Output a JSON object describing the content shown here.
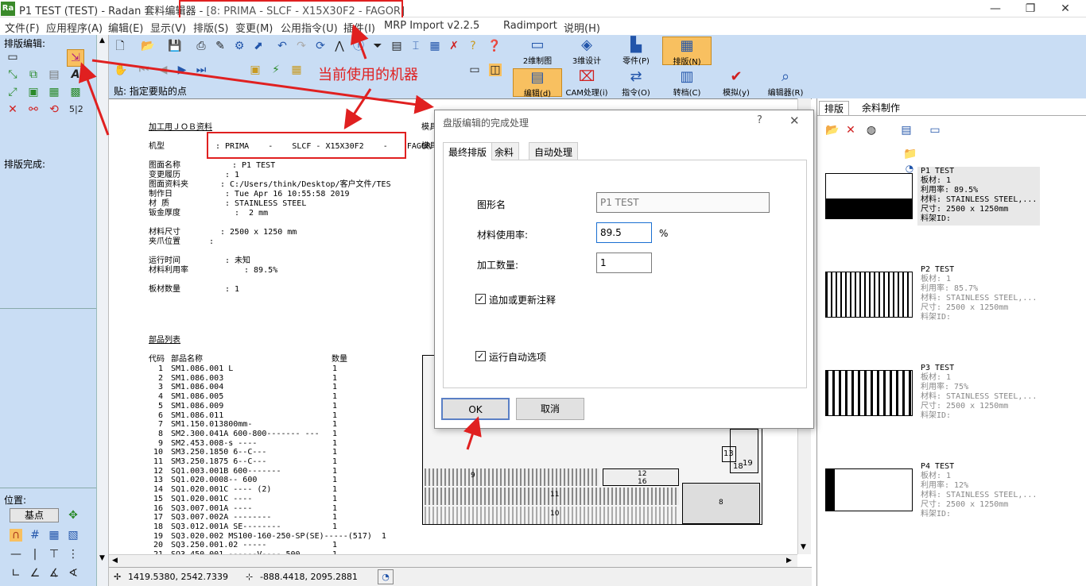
{
  "window": {
    "app_icon": "Ra",
    "title": "P1 TEST (TEST) - Radan 套料编辑器 - ",
    "title_machine": "[8: PRIMA   -   SLCF - X15X30F2   -   FAGOR]",
    "min_glyph": "—",
    "max_glyph": "❐",
    "close_glyph": "✕"
  },
  "menu": [
    "文件(F)",
    "应用程序(A)",
    "编辑(E)",
    "显示(V)",
    "排版(S)",
    "变更(M)",
    "公用指令(U)",
    "插件(I)",
    "MRP Import v2.2.5",
    "Radimport",
    "说明(H)"
  ],
  "left_panel": {
    "nest_edit_label": "排版编辑:",
    "nest_done_label": "排版完成:",
    "position_label": "位置:",
    "base_point_button": "基点",
    "fraction_label": "5|2"
  },
  "big_toolbar": {
    "row1": [
      {
        "label": "2维制图",
        "icon": "draw-2d-icon"
      },
      {
        "label": "3维设计",
        "icon": "design-3d-icon"
      },
      {
        "label": "零件(P)",
        "icon": "part-icon"
      },
      {
        "label": "排版(N)",
        "icon": "nest-icon",
        "active": true
      }
    ],
    "row2": [
      {
        "label": "编辑(d)",
        "icon": "edit-icon",
        "active": true
      },
      {
        "label": "CAM处理(i)",
        "icon": "cam-icon"
      },
      {
        "label": "指令(O)",
        "icon": "command-icon"
      },
      {
        "label": "转档(C)",
        "icon": "convert-icon"
      },
      {
        "label": "模拟(y)",
        "icon": "simulate-icon"
      },
      {
        "label": "编辑器(R)",
        "icon": "editor-icon"
      }
    ]
  },
  "prompt": "贴: 指定要贴的点",
  "annotation": "当前使用的机器",
  "job_sheet": {
    "header": "加工用ＪＯＢ资料",
    "header_right": "模具",
    "header_right2": "模具",
    "machine_label": "机型",
    "machine_value": ": PRIMA    -    SLCF - X15X30F2    -    FAGOR",
    "fields": [
      {
        "label": "图面名称",
        "value": ": P1 TEST"
      },
      {
        "label": "变更履历",
        "value": ": 1"
      },
      {
        "label": "图面资料夹",
        "value": ": C:/Users/think/Desktop/客户文件/TES"
      },
      {
        "label": "制作日",
        "value": ": Tue Apr 16 10:55:58 2019"
      },
      {
        "label": "材 质",
        "value": ": STAINLESS STEEL"
      },
      {
        "label": "钣金厚度",
        "value": ":  2 mm"
      }
    ],
    "fields2": [
      {
        "label": "材料尺寸",
        "value": ": 2500 x 1250 mm"
      },
      {
        "label": "夹爪位置",
        "value": ":"
      }
    ],
    "fields3": [
      {
        "label": "运行时间",
        "value": ": 未知"
      },
      {
        "label": "材料利用率",
        "value": ": 89.5%"
      }
    ],
    "sheet_count_label": "板材数量",
    "sheet_count_value": ": 1",
    "parts_title": "部品列表",
    "parts_header": {
      "code": "代码",
      "name": "部品名称",
      "qty": "数量"
    },
    "parts": [
      {
        "code": "1",
        "name": "SM1.086.001 L",
        "qty": "1"
      },
      {
        "code": "2",
        "name": "SM1.086.003",
        "qty": "1"
      },
      {
        "code": "3",
        "name": "SM1.086.004",
        "qty": "1"
      },
      {
        "code": "4",
        "name": "SM1.086.005",
        "qty": "1"
      },
      {
        "code": "5",
        "name": "SM1.086.009",
        "qty": "1"
      },
      {
        "code": "6",
        "name": "SM1.086.011",
        "qty": "1"
      },
      {
        "code": "7",
        "name": "SM1.150.013800mm-",
        "qty": "1"
      },
      {
        "code": "8",
        "name": "SM2.300.041A 600-800------- ---",
        "qty": "1"
      },
      {
        "code": "9",
        "name": "SM2.453.008-s ----",
        "qty": "1"
      },
      {
        "code": "10",
        "name": "SM3.250.1850 6--C---",
        "qty": "1"
      },
      {
        "code": "11",
        "name": "SM3.250.1875 6--C---",
        "qty": "1"
      },
      {
        "code": "12",
        "name": "SQ1.003.001B 600-------",
        "qty": "1"
      },
      {
        "code": "13",
        "name": "SQ1.020.0008-- 600",
        "qty": "1"
      },
      {
        "code": "14",
        "name": "SQ1.020.001C ---- (2)",
        "qty": "1"
      },
      {
        "code": "15",
        "name": "SQ1.020.001C ----",
        "qty": "1"
      },
      {
        "code": "16",
        "name": "SQ3.007.001A ----",
        "qty": "1"
      },
      {
        "code": "17",
        "name": "SQ3.007.002A --------",
        "qty": "1"
      },
      {
        "code": "18",
        "name": "SQ3.012.001A SE--------",
        "qty": "1"
      },
      {
        "code": "19",
        "name": "SQ3.020.002 MS100-160-250-SP(SE)-----(517)  1",
        "qty": ""
      },
      {
        "code": "20",
        "name": "SQ3.250.001.02 -----",
        "qty": "1"
      },
      {
        "code": "21",
        "name": "SQ3.450.001 ------V---- 500",
        "qty": "1"
      }
    ]
  },
  "nest_labels": [
    "12",
    "16",
    "11",
    "10",
    "8",
    "13",
    "18",
    "19",
    "9"
  ],
  "status": {
    "coord1": "1419.5380,  2542.7339",
    "coord2": "-888.4418,  2095.2881"
  },
  "right_panel": {
    "tabs": [
      "排版",
      "余料制作"
    ],
    "items": [
      {
        "name": "P1 TEST",
        "board": "板材: 1",
        "usage": "利用率: 89.5%",
        "material": "材料: STAINLESS STEEL,...",
        "size": "尺寸: 2500 x 1250mm",
        "rack": "料架ID:",
        "selected": true
      },
      {
        "name": "P2 TEST",
        "board": "板材: 1",
        "usage": "利用率: 85.7%",
        "material": "材料: STAINLESS STEEL,...",
        "size": "尺寸: 2500 x 1250mm",
        "rack": "料架ID:",
        "selected": false
      },
      {
        "name": "P3 TEST",
        "board": "板材: 1",
        "usage": "利用率: 75%",
        "material": "材料: STAINLESS STEEL,...",
        "size": "尺寸: 2500 x 1250mm",
        "rack": "料架ID:",
        "selected": false
      },
      {
        "name": "P4 TEST",
        "board": "板材: 1",
        "usage": "利用率: 12%",
        "material": "材料: STAINLESS STEEL,...",
        "size": "尺寸: 2500 x 1250mm",
        "rack": "料架ID:",
        "selected": false
      }
    ]
  },
  "dialog": {
    "title": "盘版编辑的完成处理",
    "help_glyph": "?",
    "close_glyph": "✕",
    "tabs": [
      "最终排版",
      "余料",
      "自动处理"
    ],
    "shape_name_label": "图形名",
    "shape_name_value": "P1 TEST",
    "usage_label": "材料使用率:",
    "usage_value": "89.5",
    "usage_unit": "%",
    "qty_label": "加工数量:",
    "qty_value": "1",
    "check1_label": "追加或更新注释",
    "check2_label": "运行自动选项",
    "ok": "OK",
    "cancel": "取消"
  }
}
